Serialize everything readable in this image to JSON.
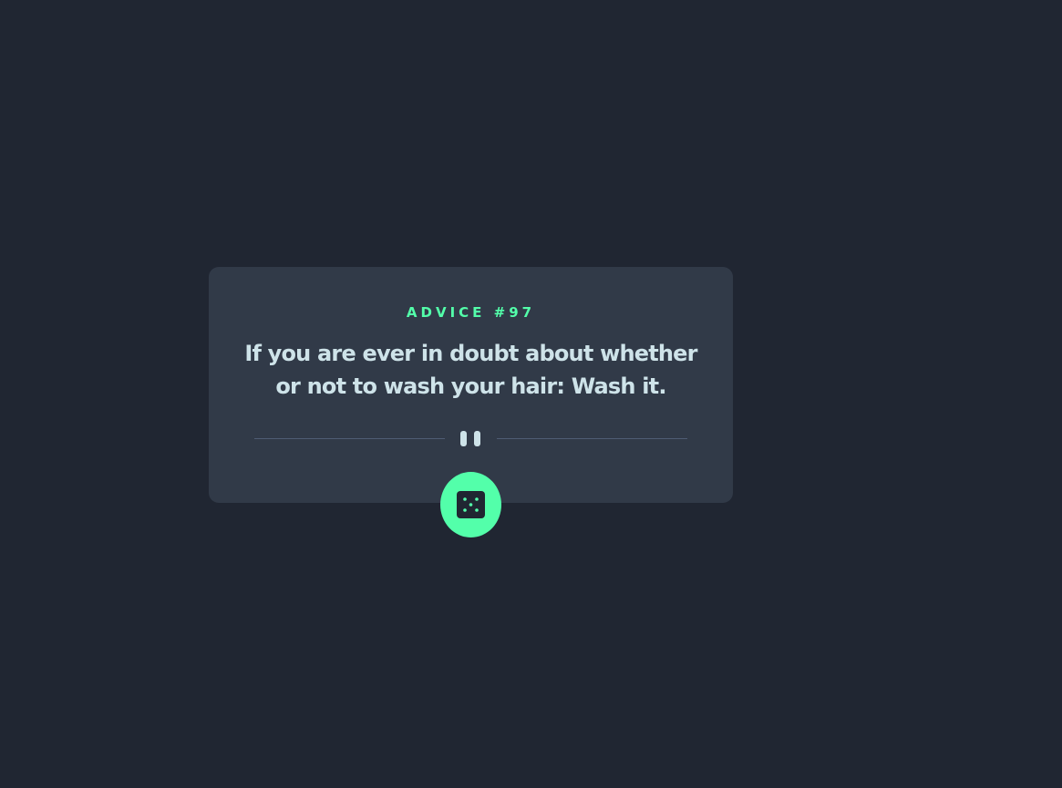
{
  "advice": {
    "id_label": "ADVICE #97",
    "text": "If you are ever in doubt about whether or not to wash your hair: Wash it."
  },
  "button": {
    "icon": "dice-icon",
    "action": "generate-new-advice"
  },
  "divider": {
    "icon": "pause-icon"
  },
  "colors": {
    "background": "#202632",
    "card": "#313a48",
    "accent": "#53ffaa",
    "text": "#cee3e9",
    "divider": "#4f5d74"
  }
}
